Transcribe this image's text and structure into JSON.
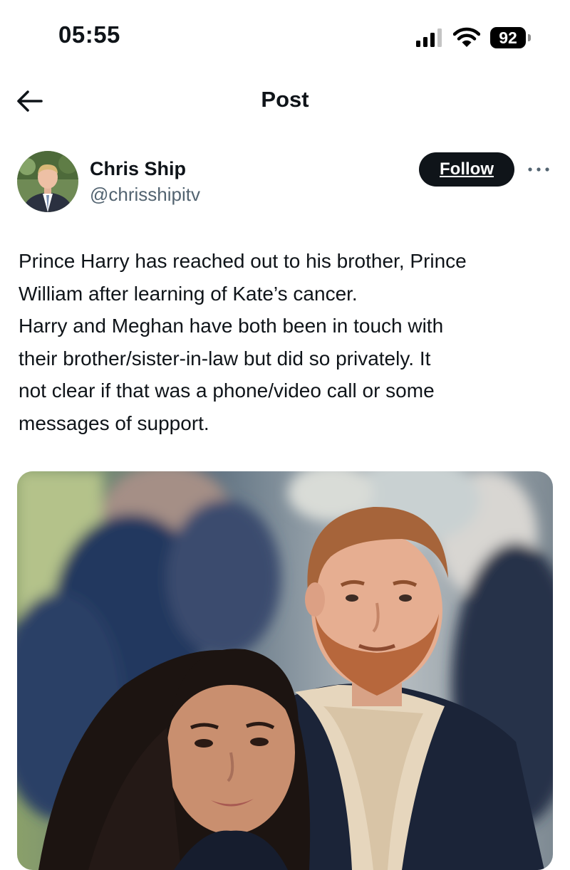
{
  "status_bar": {
    "time": "05:55",
    "battery_level": "92",
    "icons": [
      "signal-icon",
      "wifi-icon",
      "battery-icon"
    ]
  },
  "header": {
    "title": "Post",
    "back_icon": "back-arrow-icon"
  },
  "author": {
    "name": "Chris Ship",
    "handle": "@chrisshipitv",
    "follow_label": "Follow",
    "more_icon": "more-icon"
  },
  "post": {
    "lines": [
      "Prince Harry has reached out to his brother, Prince",
      "William after learning of Kate’s cancer.",
      "Harry and Meghan have both been in touch with",
      "their brother/sister-in-law but did so privately. It",
      "not clear if that was a phone/video call or some",
      "messages of support."
    ]
  },
  "colors": {
    "text_primary": "#0f1419",
    "text_secondary": "#536471",
    "follow_bg": "#0f1419",
    "follow_text": "#ffffff",
    "background": "#ffffff"
  }
}
